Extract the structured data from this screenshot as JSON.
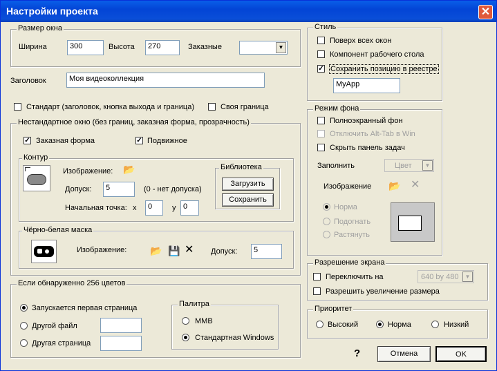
{
  "window": {
    "title": "Настройки проекта",
    "close": "✕"
  },
  "size": {
    "legend": "Размер окна",
    "width_label": "Ширина",
    "width": "300",
    "height_label": "Высота",
    "height": "270",
    "custom_label": "Заказные",
    "custom_value": ""
  },
  "caption": {
    "label": "Заголовок",
    "value": "Моя видеоколлекция"
  },
  "frame": {
    "standard": "Стандарт (заголовок, кнопка выхода и граница)",
    "own_border": "Своя граница"
  },
  "nonstd": {
    "legend": "Нестандартное окно (без границ, заказная форма, прозрачность)",
    "custom_form": "Заказная форма",
    "movable": "Подвижное"
  },
  "contour": {
    "legend": "Контур",
    "image_label": "Изображение:",
    "tol_label": "Допуск:",
    "tol": "5",
    "tol_note": "(0 - нет допуска)",
    "start_label": "Начальная точка:",
    "x_label": "x",
    "x": "0",
    "y_label": "y",
    "y": "0"
  },
  "library": {
    "legend": "Библиотека",
    "load": "Загрузить",
    "save": "Сохранить"
  },
  "mask": {
    "legend": "Чёрно-белая маска",
    "image_label": "Изображение:",
    "tol_label": "Допуск:",
    "tol": "5"
  },
  "colors256": {
    "legend": "Если обнаруженно 256  цветов",
    "first_page": "Запускается первая страница",
    "other_file": "Другой файл",
    "other_page": "Другая страница"
  },
  "palette": {
    "legend": "Палитра",
    "mmb": "MMB",
    "std": "Стандартная Windows"
  },
  "style": {
    "legend": "Стиль",
    "on_top": "Поверх всех окон",
    "desktop": "Компонент рабочего стола",
    "save_pos": "Сохранить позицию в реестре",
    "app": "MyApp"
  },
  "bg": {
    "legend": "Режим фона",
    "fullscreen": "Полноэкранный фон",
    "alt_tab": "Отключить Alt-Tab в Win",
    "hide_taskbar": "Скрыть панель задач",
    "fill_label": "Заполнить",
    "fill_value": "Цвет",
    "image_label": "Изображение",
    "normal": "Норма",
    "fit": "Подогнать",
    "stretch": "Растянуть"
  },
  "res": {
    "legend": "Разрешение экрана",
    "switch": "Переключить на",
    "mode": "640 by 480",
    "allow": "Разрешить увеличение размера"
  },
  "prio": {
    "legend": "Приоритет",
    "high": "Высокий",
    "normal": "Норма",
    "low": "Низкий"
  },
  "buttons": {
    "help": "?",
    "cancel": "Отмена",
    "ok": "OK"
  },
  "checks": {
    "mark": "✓"
  }
}
